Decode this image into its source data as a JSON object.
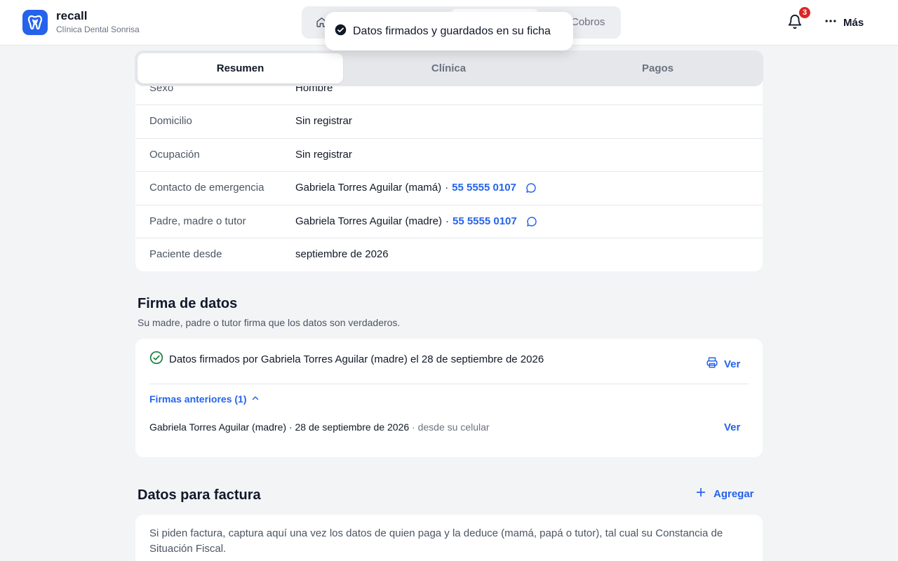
{
  "brand": {
    "name": "recall",
    "clinic": "Clínica Dental Sonrisa"
  },
  "topnav": {
    "tab_cobros": "Cobros"
  },
  "notifications": {
    "count": "3"
  },
  "more": {
    "label": "Más"
  },
  "toast": {
    "message": "Datos firmados y guardados en su ficha"
  },
  "tabs": [
    {
      "label": "Resumen",
      "active": true
    },
    {
      "label": "Clínica",
      "active": false
    },
    {
      "label": "Pagos",
      "active": false
    }
  ],
  "info": {
    "partial_label": "Sexo",
    "partial_value": "Hombre",
    "rows": [
      {
        "label": "Domicilio",
        "value": "Sin registrar"
      },
      {
        "label": "Ocupación",
        "value": "Sin registrar"
      },
      {
        "label": "Contacto de emergencia",
        "name": "Gabriela Torres Aguilar (mamá)",
        "sep": "·",
        "phone": "55 5555 0107"
      },
      {
        "label": "Padre, madre o tutor",
        "name": "Gabriela Torres Aguilar (madre)",
        "sep": "·",
        "phone": "55 5555 0107"
      },
      {
        "label": "Paciente desde",
        "value": "septiembre de 2026"
      }
    ]
  },
  "firma": {
    "title": "Firma de datos",
    "subtitle": "Su madre, padre o tutor firma que los datos son verdaderos.",
    "signed_text": "Datos firmados por Gabriela Torres Aguilar (madre) el 28 de septiembre de 2026",
    "ver_label": "Ver",
    "previous_toggle": "Firmas anteriores (1)",
    "previous": [
      {
        "who_when": "Gabriela Torres Aguilar (madre) · 28 de septiembre de 2026",
        "via": "· desde su celular",
        "ver_label": "Ver"
      }
    ]
  },
  "factura": {
    "title": "Datos para factura",
    "add_label": "Agregar",
    "description": "Si piden factura, captura aquí una vez los datos de quien paga y la deduce (mamá, papá o tutor), tal cual su Constancia de Situación Fiscal."
  },
  "colors": {
    "accent": "#2563eb",
    "success": "#15803d",
    "danger": "#dc2626"
  }
}
